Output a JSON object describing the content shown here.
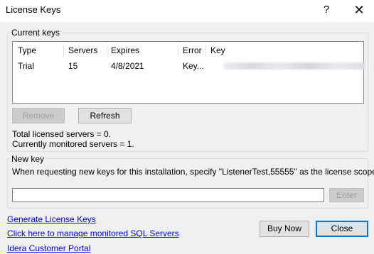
{
  "window": {
    "title": "License Keys",
    "help_glyph": "?",
    "close_glyph": "✕"
  },
  "current_keys": {
    "group_label": "Current keys",
    "columns": [
      "Type",
      "Servers",
      "Expires",
      "Error",
      "Key"
    ],
    "rows": [
      {
        "type": "Trial",
        "servers": "15",
        "expires": "4/8/2021",
        "error": "Key..."
      }
    ],
    "remove_label": "Remove",
    "refresh_label": "Refresh",
    "total_licensed": "Total licensed servers = 0.",
    "currently_monitored": "Currently monitored servers = 1."
  },
  "new_key": {
    "group_label": "New key",
    "instruction": "When requesting new keys for this installation, specify \"ListenerTest,55555\" as the license scope.",
    "input_value": "",
    "enter_label": "Enter"
  },
  "links": {
    "generate": "Generate License Keys",
    "manage": "Click here to manage monitored SQL Servers",
    "portal": "Idera Customer Portal"
  },
  "footer": {
    "buy_now_label": "Buy Now",
    "close_label": "Close"
  }
}
